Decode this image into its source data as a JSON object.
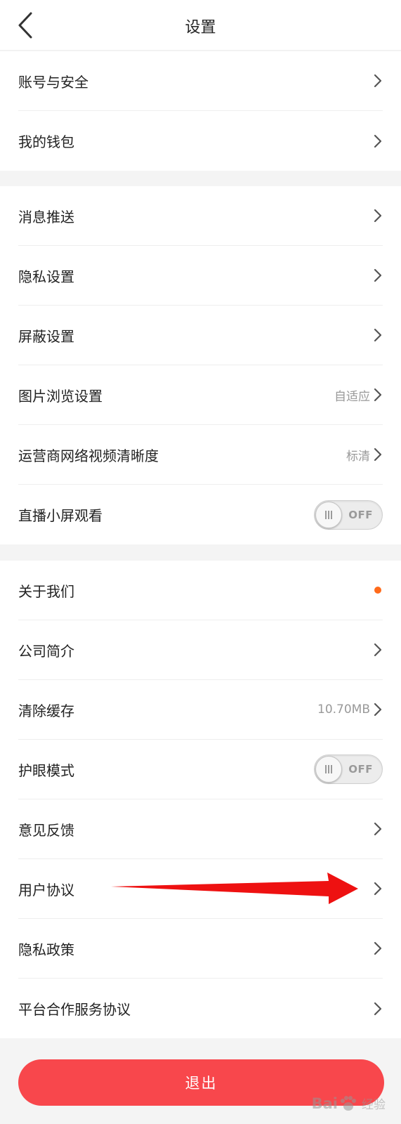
{
  "header": {
    "title": "设置"
  },
  "groups": [
    {
      "items": [
        {
          "label": "账号与安全"
        },
        {
          "label": "我的钱包"
        }
      ]
    },
    {
      "items": [
        {
          "label": "消息推送"
        },
        {
          "label": "隐私设置"
        },
        {
          "label": "屏蔽设置"
        },
        {
          "label": "图片浏览设置",
          "value": "自适应"
        },
        {
          "label": "运营商网络视频清晰度",
          "value": "标清"
        },
        {
          "label": "直播小屏观看",
          "toggle": "OFF"
        }
      ]
    },
    {
      "items": [
        {
          "label": "关于我们"
        },
        {
          "label": "公司简介"
        },
        {
          "label": "清除缓存",
          "value": "10.70MB"
        },
        {
          "label": "护眼模式",
          "toggle": "OFF"
        },
        {
          "label": "意见反馈"
        },
        {
          "label": "用户协议"
        },
        {
          "label": "隐私政策"
        },
        {
          "label": "平台合作服务协议"
        }
      ]
    }
  ],
  "logout_label": "退出",
  "watermark": {
    "brand": "Bai",
    "suffix": "经验"
  },
  "icons": {
    "back": "chevron-left-icon",
    "row": "chevron-right-icon",
    "notice": "notification-dot-icon",
    "annotation": "red-arrow-icon"
  },
  "colors": {
    "accent_red": "#f8474c",
    "notification_dot": "#ff6a1a",
    "annotation_arrow": "#ee1111"
  }
}
